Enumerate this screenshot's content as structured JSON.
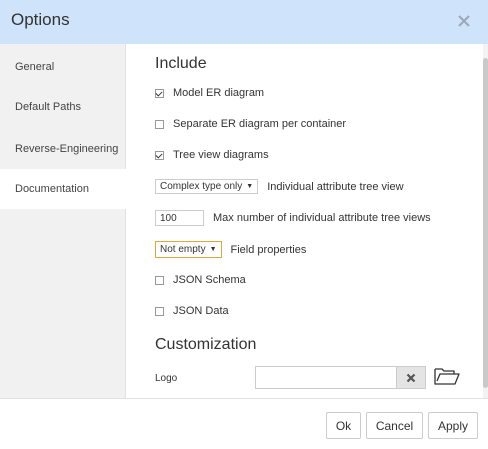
{
  "dialog": {
    "title": "Options"
  },
  "sidebar": {
    "items": [
      {
        "label": "General"
      },
      {
        "label": "Default Paths"
      },
      {
        "label": "Reverse-Engineering"
      },
      {
        "label": "Documentation"
      }
    ],
    "active": "Documentation"
  },
  "include": {
    "heading": "Include",
    "model_er": {
      "label": "Model ER diagram",
      "checked": true
    },
    "separate_er": {
      "label": "Separate ER diagram per container",
      "checked": false
    },
    "tree_view": {
      "label": "Tree view diagrams",
      "checked": true
    },
    "complex_type": {
      "value": "Complex type only",
      "label": "Individual attribute tree view"
    },
    "max_views": {
      "value": "100",
      "label": "Max number of individual attribute tree views"
    },
    "field_props": {
      "value": "Not empty",
      "label": "Field properties"
    },
    "json_schema": {
      "label": "JSON Schema",
      "checked": false
    },
    "json_data": {
      "label": "JSON Data",
      "checked": false
    }
  },
  "customization": {
    "heading": "Customization",
    "logo_label": "Logo",
    "logo_value": ""
  },
  "footer": {
    "ok": "Ok",
    "cancel": "Cancel",
    "apply": "Apply"
  },
  "colors": {
    "titlebar": "#cfe3fa",
    "sidebar": "#f1f1f1",
    "highlight_border": "#d9a93a"
  }
}
